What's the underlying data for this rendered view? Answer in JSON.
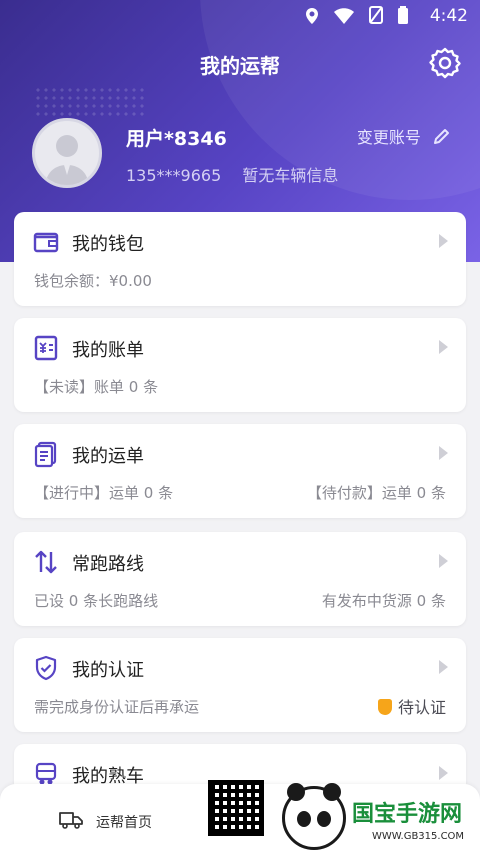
{
  "status_bar": {
    "time": "4:42",
    "icons": [
      "location-icon",
      "wifi-icon",
      "no-sim-icon",
      "battery-icon"
    ]
  },
  "header": {
    "title": "我的运帮",
    "settings_icon": "gear-icon"
  },
  "profile": {
    "username": "用户*8346",
    "phone": "135***9665",
    "vehicle": "暂无车辆信息",
    "change_account": "变更账号"
  },
  "cards": {
    "wallet": {
      "title": "我的钱包",
      "left": "钱包余额：¥0.00",
      "icon": "wallet-icon"
    },
    "bill": {
      "title": "我的账单",
      "left": "【未读】账单 0 条",
      "icon": "bill-icon"
    },
    "waybill": {
      "title": "我的运单",
      "left": "【进行中】运单 0 条",
      "right": "【待付款】运单 0 条",
      "icon": "document-icon"
    },
    "route": {
      "title": "常跑路线",
      "left": "已设 0 条长跑路线",
      "right": "有发布中货源 0 条",
      "icon": "swap-arrows-icon"
    },
    "cert": {
      "title": "我的认证",
      "left": "需完成身份认证后再承运",
      "right": "待认证",
      "icon": "shield-check-icon"
    },
    "familiar": {
      "title": "我的熟车",
      "icon": "truck-icon"
    }
  },
  "bottom_nav": {
    "home_label": "运帮首页"
  },
  "watermark": {
    "brand": "国宝手游网",
    "url": "WWW.GB315.COM"
  },
  "colors": {
    "header_start": "#3a2d8f",
    "header_end": "#7a63e6",
    "accent": "#5744c4",
    "warning": "#f6a51a"
  }
}
